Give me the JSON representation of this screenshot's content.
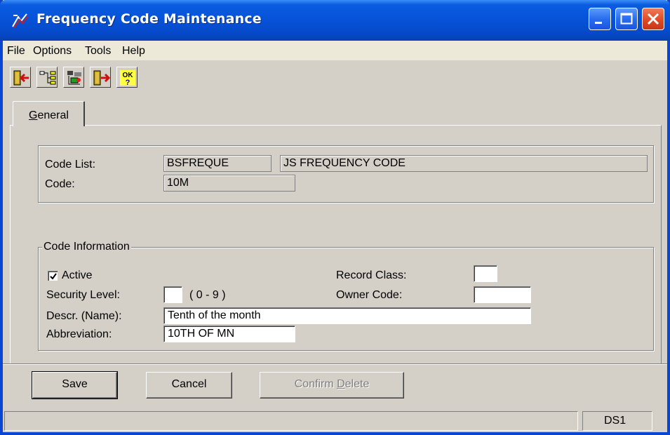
{
  "window": {
    "title": "Frequency Code Maintenance",
    "controls": {
      "minimize": "minimize-icon",
      "maximize": "maximize-icon",
      "close": "close-icon"
    }
  },
  "menu": [
    "File",
    "Options",
    "Tools",
    "Help"
  ],
  "toolbar": {
    "tools": [
      "exit-door-icon",
      "tree-view-icon",
      "lookup-icon",
      "next-door-icon",
      "ok-help-icon"
    ],
    "ok_label": "OK",
    "help_mark": "?"
  },
  "tabs": {
    "general": {
      "prefix": "G",
      "rest": "eneral"
    }
  },
  "header_group": {
    "code_list_label": "Code List:",
    "code_list_value": "BSFREQUE",
    "code_list_desc": "JS FREQUENCY CODE",
    "code_label": "Code:",
    "code_value": "10M"
  },
  "code_info": {
    "title": "Code Information",
    "active_label": "Active",
    "active_checked": true,
    "security_label": "Security Level:",
    "security_value": "",
    "security_range": "( 0 - 9 )",
    "descr_label": "Descr. (Name):",
    "descr_value": "Tenth of the month",
    "abbrev_label": "Abbreviation:",
    "abbrev_value": "10TH OF MN",
    "record_class_label": "Record Class:",
    "record_class_value": "",
    "owner_code_label": "Owner Code:",
    "owner_code_value": ""
  },
  "buttons": {
    "save": "Save",
    "cancel": "Cancel",
    "confirm_delete_prefix": "Confirm ",
    "confirm_delete_mnemonic": "D",
    "confirm_delete_suffix": "elete"
  },
  "status": {
    "pane_right": "DS1"
  },
  "colors": {
    "titlebar": "#0652d8",
    "face": "#d4d0c8",
    "close": "#e04a24"
  }
}
